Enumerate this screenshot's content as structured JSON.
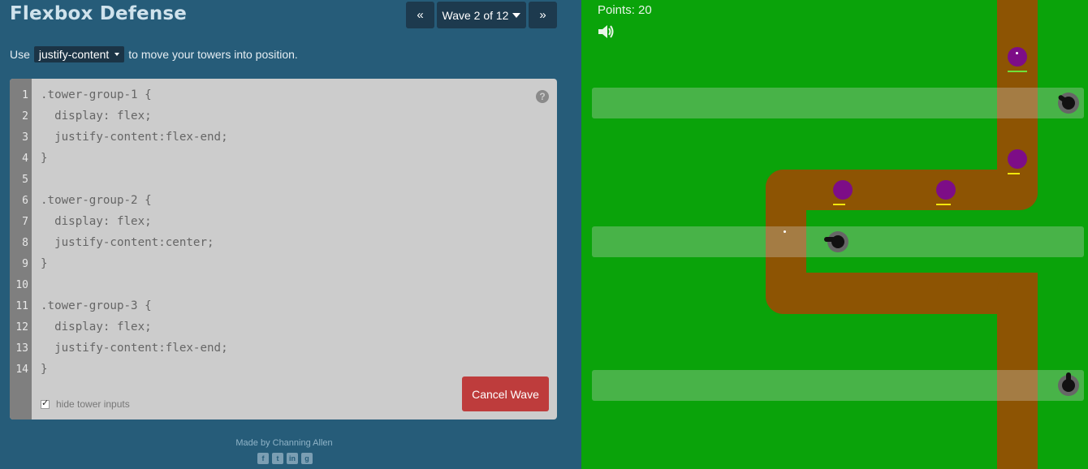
{
  "app": {
    "title": "Flexbox Defense"
  },
  "nav": {
    "prev_icon": "«",
    "wave_label": "Wave 2 of 12",
    "next_icon": "»"
  },
  "instructions": {
    "prefix": "Use",
    "property": "justify-content",
    "suffix": "to move your towers into position."
  },
  "editor": {
    "line_numbers": [
      "1",
      "2",
      "3",
      "4",
      "5",
      "6",
      "7",
      "8",
      "9",
      "10",
      "11",
      "12",
      "13",
      "14"
    ],
    "lines": [
      ".tower-group-1 {",
      "  display: flex;",
      "  justify-content:flex-end;",
      "}",
      "",
      ".tower-group-2 {",
      "  display: flex;",
      "  justify-content:center;",
      "}",
      "",
      ".tower-group-3 {",
      "  display: flex;",
      "  justify-content:flex-end;",
      "}"
    ],
    "help_icon": "?",
    "hide_inputs_label": "hide tower inputs",
    "hide_inputs_checked": true,
    "cancel_label": "Cancel Wave"
  },
  "footer": {
    "credit": "Made by Channing Allen",
    "socials": [
      "facebook-icon",
      "twitter-icon",
      "linkedin-icon",
      "github-icon"
    ]
  },
  "game": {
    "points_label": "Points: 20",
    "sound_icon": "speaker-icon",
    "colors": {
      "grass": "#0aa30a",
      "path": "#8d5403",
      "enemy": "#7d0d87",
      "cancel": "#be3c3c"
    }
  }
}
